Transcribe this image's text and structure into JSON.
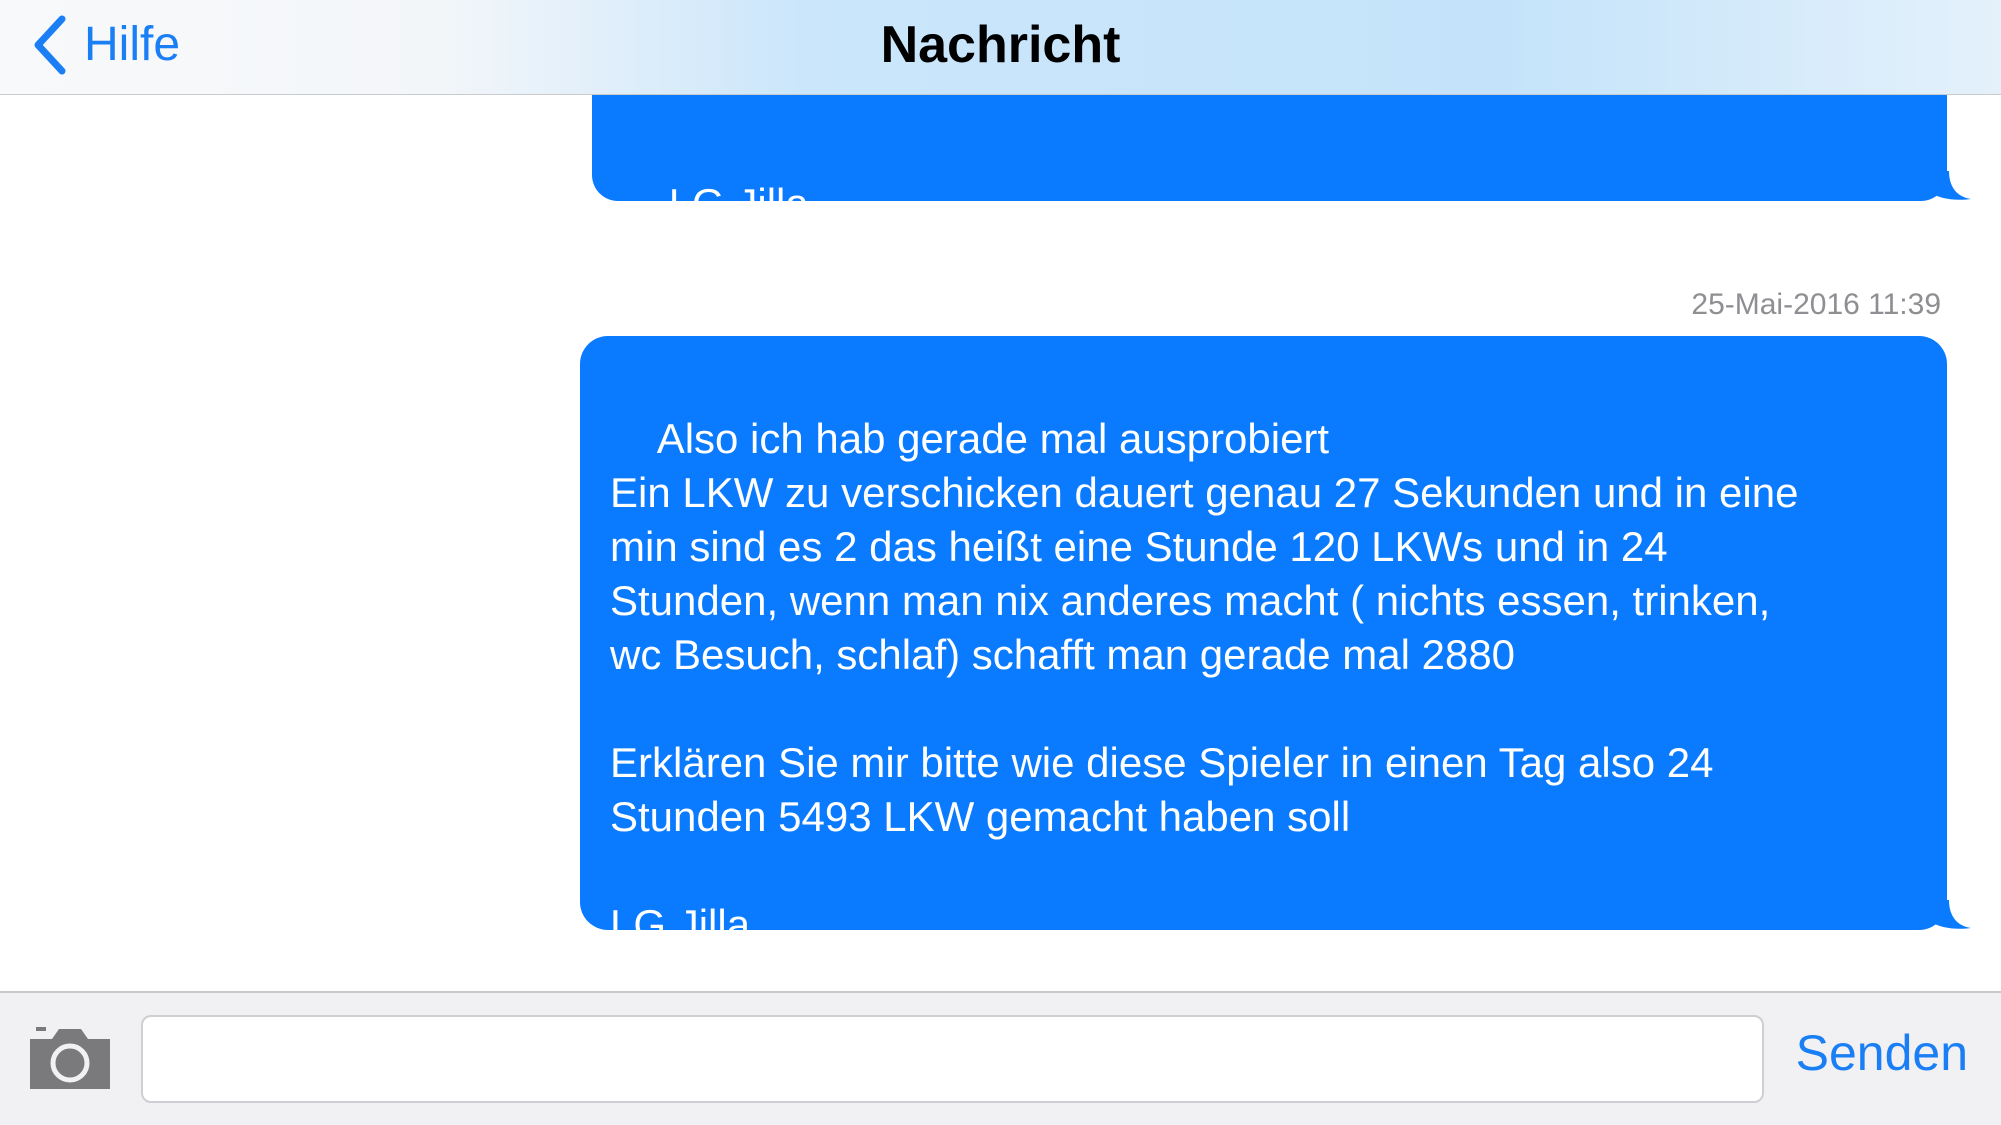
{
  "header": {
    "back_label": "Hilfe",
    "title": "Nachricht"
  },
  "messages": [
    {
      "text": "LG Jilla",
      "timestamp": ""
    },
    {
      "timestamp": "25-Mai-2016 11:39",
      "text": "Also ich hab gerade mal ausprobiert\nEin LKW zu verschicken dauert genau 27 Sekunden und in eine\nmin sind es 2 das heißt eine Stunde 120 LKWs und in 24\nStunden, wenn man nix anderes macht ( nichts essen, trinken,\nwc Besuch, schlaf) schafft man gerade mal 2880\n\nErklären Sie mir bitte wie diese Spieler in einen Tag also 24\nStunden 5493 LKW gemacht haben soll\n\nLG Jilla"
    }
  ],
  "composer": {
    "input_value": "",
    "input_placeholder": "",
    "send_label": "Senden",
    "camera_icon": "camera-icon"
  },
  "colors": {
    "accent": "#1a7ff5",
    "bubble": "#0a7aff",
    "timestamp": "#8e8e93"
  }
}
